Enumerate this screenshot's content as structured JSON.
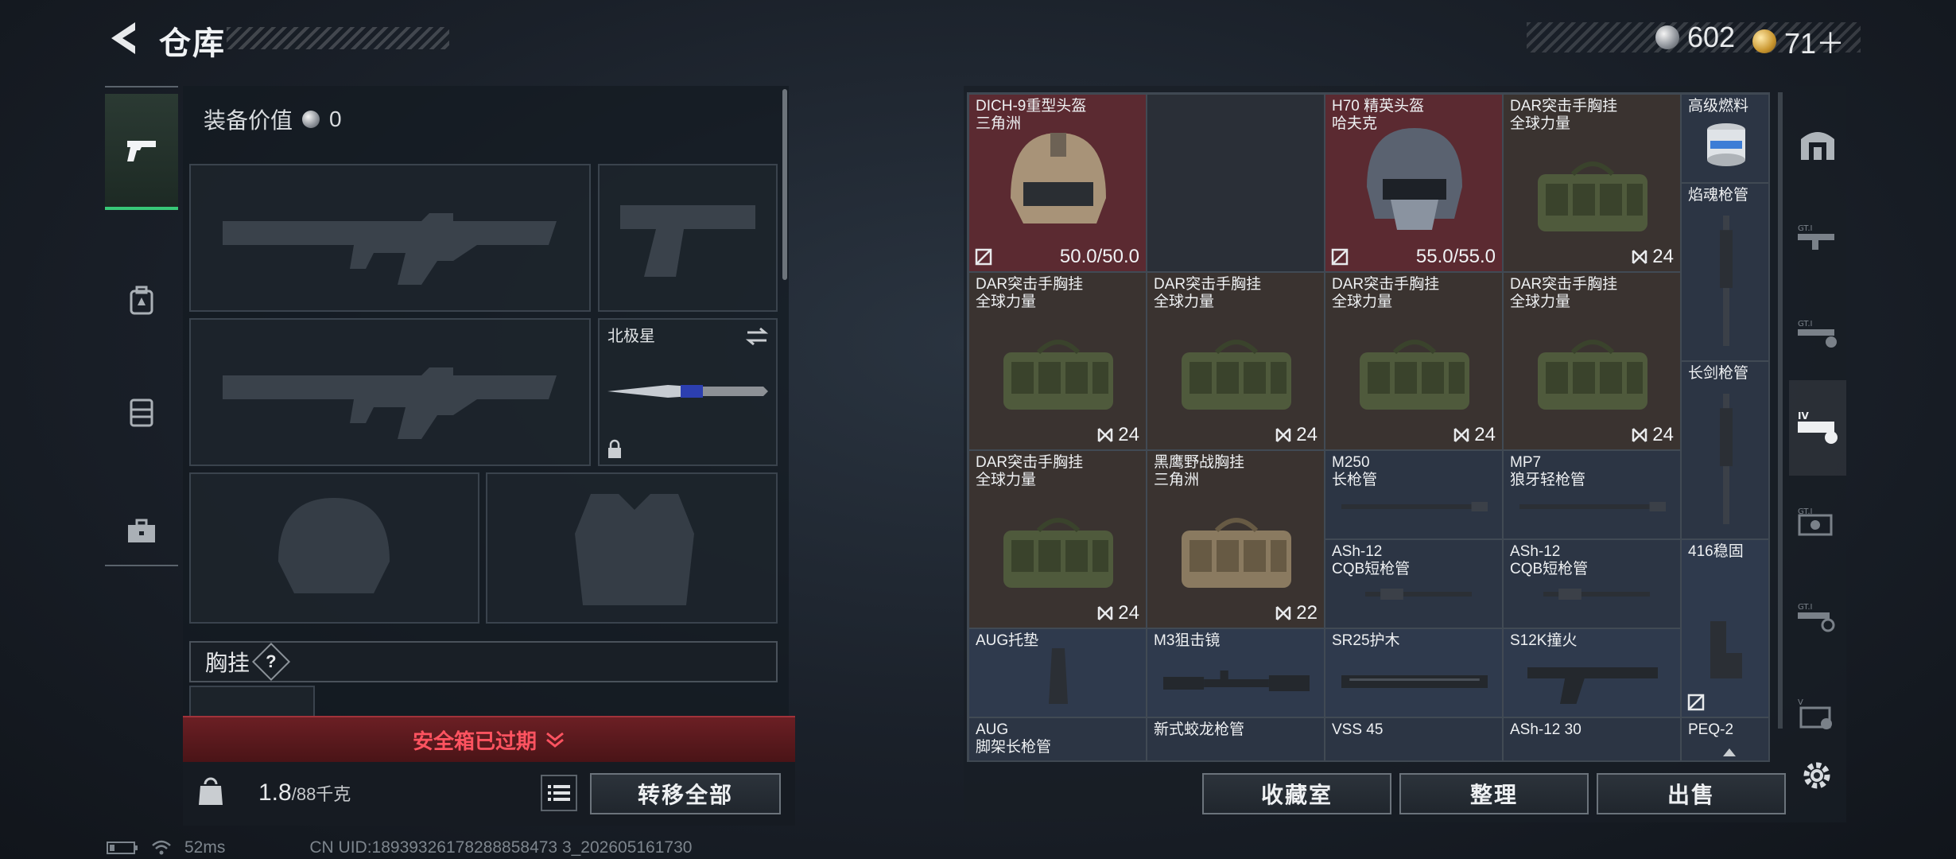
{
  "header": {
    "title": "仓库"
  },
  "currency": {
    "silver": "602",
    "gold": "71＋"
  },
  "left_nav": {
    "items": [
      "weapons",
      "backpack",
      "armor",
      "toolbox"
    ]
  },
  "equipment": {
    "value_label": "装备价值",
    "value": "0",
    "knife_slot_label": "北极星",
    "chest_label": "胸挂",
    "chest_help": "?"
  },
  "safebox": {
    "label": "安全箱已过期"
  },
  "bottom_left": {
    "weight": "1.8",
    "weight_unit": "/88千克",
    "transfer_all": "转移全部"
  },
  "inventory": [
    {
      "line1": "DICH-9重型头盔",
      "line2": "三角洲",
      "durability": "50.0/50.0",
      "bg": "red"
    },
    {
      "line1": "H70 精英头盔",
      "line2": "哈夫克",
      "durability": "55.0/55.0",
      "bg": "red"
    },
    {
      "line1": "DAR突击手胸挂",
      "line2": "全球力量",
      "count": "24",
      "bg": "brown"
    },
    {
      "line1": "高级燃料",
      "line2": "",
      "bg": "slate"
    },
    {
      "line1": "焰魂枪管",
      "line2": "",
      "bg": "slate"
    },
    {
      "line1": "DAR突击手胸挂",
      "line2": "全球力量",
      "count": "24",
      "bg": "brown"
    },
    {
      "line1": "DAR突击手胸挂",
      "line2": "全球力量",
      "count": "24",
      "bg": "brown"
    },
    {
      "line1": "DAR突击手胸挂",
      "line2": "全球力量",
      "count": "24",
      "bg": "brown"
    },
    {
      "line1": "DAR突击手胸挂",
      "line2": "全球力量",
      "count": "24",
      "bg": "brown"
    },
    {
      "line1": "长剑枪管",
      "line2": "",
      "bg": "slate"
    },
    {
      "line1": "DAR突击手胸挂",
      "line2": "全球力量",
      "count": "24",
      "bg": "brown"
    },
    {
      "line1": "黑鹰野战胸挂",
      "line2": "三角洲",
      "count": "22",
      "bg": "brown"
    },
    {
      "line1": "M250",
      "line2": "长枪管",
      "bg": "slate"
    },
    {
      "line1": "MP7",
      "line2": "狼牙轻枪管",
      "bg": "slate"
    },
    {
      "line1": "ASh-12",
      "line2": "CQB短枪管",
      "bg": "slate"
    },
    {
      "line1": "ASh-12",
      "line2": "CQB短枪管",
      "bg": "slate"
    },
    {
      "line1": "416稳固",
      "line2": "",
      "bg": "blue"
    },
    {
      "line1": "AUG托垫",
      "line2": "",
      "bg": "blue"
    },
    {
      "line1": "M3狙击镜",
      "line2": "",
      "bg": "blue"
    },
    {
      "line1": "SR25护木",
      "line2": "",
      "bg": "blue"
    },
    {
      "line1": "S12K撞火",
      "line2": "",
      "bg": "blue"
    },
    {
      "line1": "AUG",
      "line2": "脚架长枪管",
      "bg": "slate"
    },
    {
      "line1": "新式蛟龙枪管",
      "line2": "",
      "bg": "slate"
    },
    {
      "line1": "VSS 45",
      "line2": "",
      "bg": "slate"
    },
    {
      "line1": "ASh-12 30",
      "line2": "",
      "bg": "slate"
    },
    {
      "line1": "PEQ-2",
      "line2": "",
      "bg": "slate"
    }
  ],
  "actions": {
    "collection": "收藏室",
    "organize": "整理",
    "sell": "出售"
  },
  "status": {
    "ping": "52ms",
    "uid": "CN UID:18939326178288858473 3_202605161730"
  },
  "colors": {
    "accent_green": "#38c878",
    "warn_red": "#ff5360"
  }
}
